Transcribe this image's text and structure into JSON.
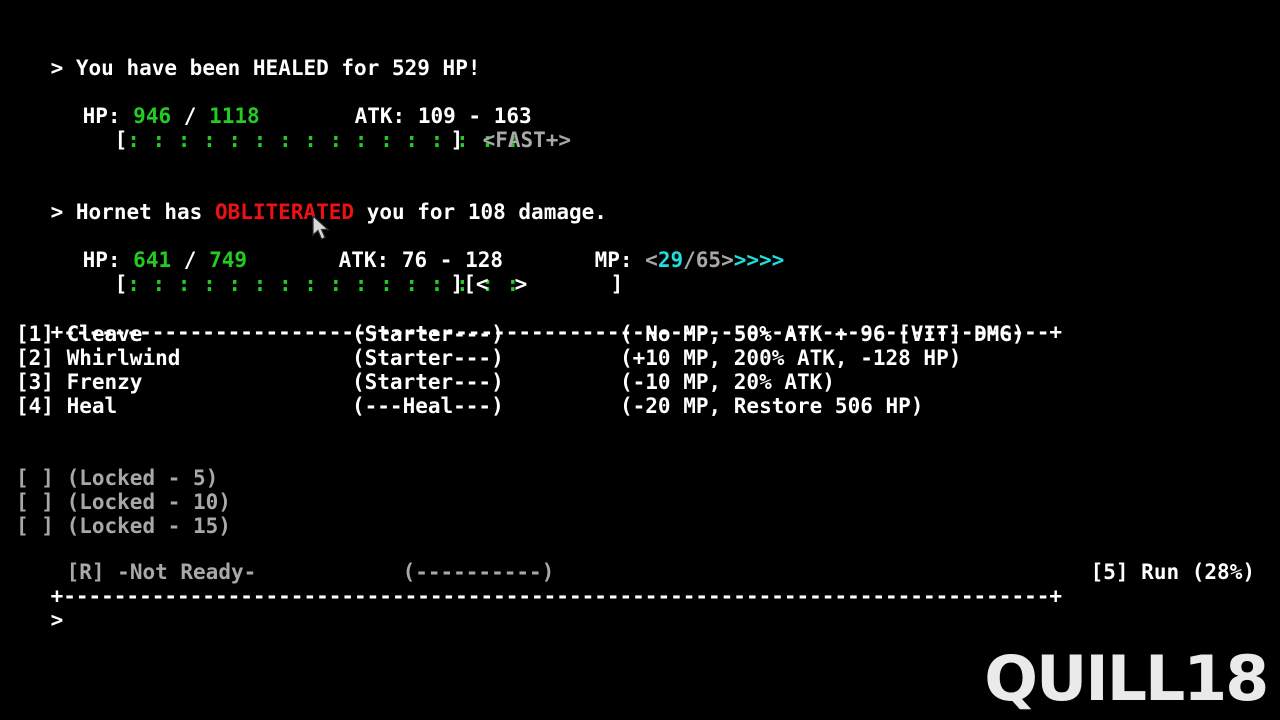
{
  "screen": {
    "background": "#000000",
    "foreground": "#ffffff",
    "colors": {
      "white": "#ffffff",
      "green": "#22cc22",
      "red": "#ee1111",
      "cyan": "#22dddd",
      "gray": "#a8a8a8"
    },
    "columns": 80,
    "rows": 30
  },
  "log": {
    "prompt": ">",
    "line1": {
      "pre": "You have been ",
      "keyword": "HEALED",
      "post": " for 529 HP!",
      "keyword_color": "#ffffff",
      "amount": "529"
    },
    "line2": {
      "pre": "Hornet has ",
      "keyword": "OBLITERATED",
      "post": " you for 108 damage.",
      "keyword_color": "#ee1111",
      "enemy": "Hornet",
      "damage": "108"
    }
  },
  "enemy_status": {
    "hp_label": "HP:",
    "hp_current": "946",
    "hp_separator": "/",
    "hp_max": "1118",
    "atk_label": "ATK:",
    "atk_min": "109",
    "atk_dash": "-",
    "atk_max": "163",
    "bar_open": "[",
    "bar_fill": ": : : : : : : : : : : : : : : :",
    "bar_close": "]",
    "speed_tag": "<FAST+>"
  },
  "player_status": {
    "hp_label": "HP:",
    "hp_current": "641",
    "hp_separator": "/",
    "hp_max": "749",
    "atk_label": "ATK:",
    "atk_min": "76",
    "atk_dash": "-",
    "atk_max": "128",
    "mp_label": "MP:",
    "mp_open": "<",
    "mp_current": "29",
    "mp_slash": "/",
    "mp_max": "65",
    "mp_close": ">",
    "mp_arrows": ">>>>",
    "bar_open": "[",
    "bar_fill": ": : : : : : : : : : : : : : : :",
    "bar_close": "]",
    "speed_open": "[",
    "speed_left": "<",
    "speed_right": ">",
    "speed_close": "]"
  },
  "separator": {
    "corner": "+",
    "fill": "-",
    "length": 78
  },
  "skills": [
    {
      "key": "[1]",
      "name": "Cleave",
      "tag": "(Starter---)",
      "detail": "( No MP, 50% ATK + 96 [VIT] DMG)",
      "locked": false
    },
    {
      "key": "[2]",
      "name": "Whirlwind",
      "tag": "(Starter---)",
      "detail": "(+10 MP, 200% ATK, -128 HP)",
      "locked": false
    },
    {
      "key": "[3]",
      "name": "Frenzy",
      "tag": "(Starter---)",
      "detail": "(-10 MP, 20% ATK)",
      "locked": false
    },
    {
      "key": "[4]",
      "name": "Heal",
      "tag": "(---Heal---)",
      "detail": "(-20 MP, Restore 506 HP)",
      "locked": false
    }
  ],
  "locked_slots": [
    {
      "key": "[ ]",
      "label": "(Locked - 5)"
    },
    {
      "key": "[ ]",
      "label": "(Locked - 10)"
    },
    {
      "key": "[ ]",
      "label": "(Locked - 15)"
    }
  ],
  "ultimate": {
    "key": "[R]",
    "label": "-Not Ready-",
    "tag": "(----------)"
  },
  "run_action": {
    "key": "[5]",
    "label": "Run",
    "chance": "(28%)"
  },
  "input": {
    "prompt": ">",
    "value": ""
  },
  "watermark": {
    "text": "QUILL18"
  }
}
